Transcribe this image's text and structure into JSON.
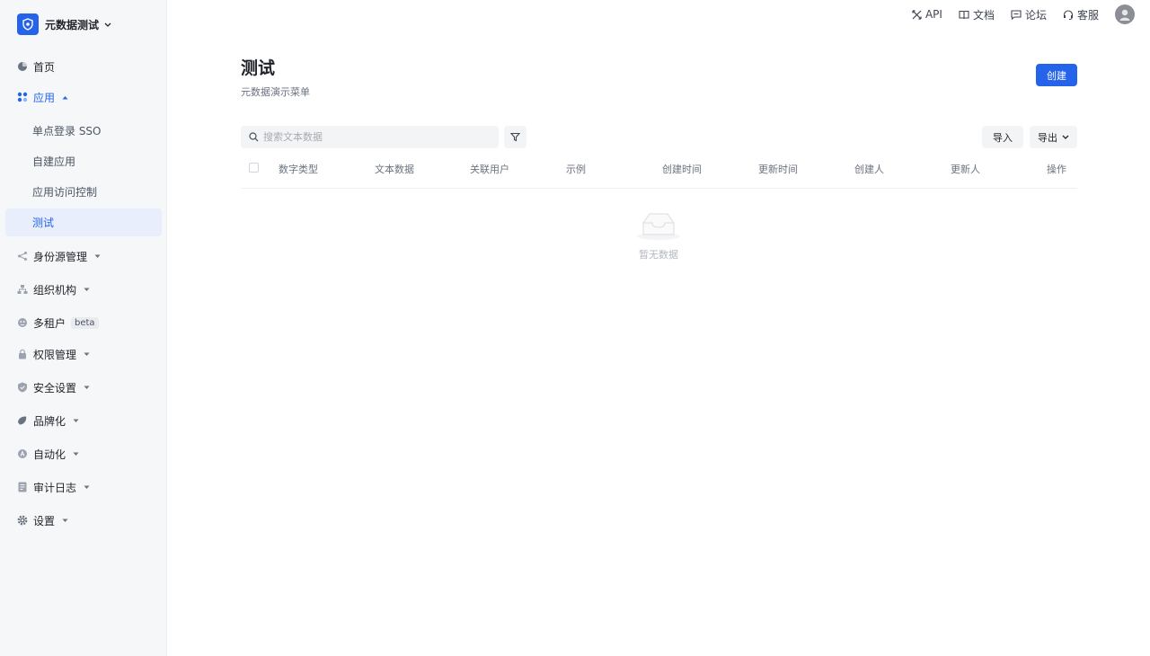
{
  "app": {
    "name": "元数据测试"
  },
  "topbar": {
    "links": [
      {
        "label": "API",
        "icon": "api-icon"
      },
      {
        "label": "文档",
        "icon": "book-icon"
      },
      {
        "label": "论坛",
        "icon": "forum-icon"
      },
      {
        "label": "客服",
        "icon": "headset-icon"
      }
    ]
  },
  "sidebar": {
    "home": "首页",
    "apps": "应用",
    "app_children": [
      "单点登录 SSO",
      "自建应用",
      "应用访问控制",
      "测试"
    ],
    "identity_source": "身份源管理",
    "organization": "组织机构",
    "multi_tenant": "多租户",
    "multi_tenant_badge": "beta",
    "permissions": "权限管理",
    "security": "安全设置",
    "branding": "品牌化",
    "automation": "自动化",
    "audit_log": "审计日志",
    "settings": "设置"
  },
  "page": {
    "title": "测试",
    "description": "元数据演示菜单",
    "create_label": "创建",
    "search_placeholder": "搜索文本数据",
    "import_label": "导入",
    "export_label": "导出"
  },
  "table": {
    "columns": [
      "数字类型",
      "文本数据",
      "关联用户",
      "示例",
      "创建时间",
      "更新时间",
      "创建人",
      "更新人",
      "操作"
    ],
    "rows": [],
    "empty_text": "暂无数据"
  },
  "colors": {
    "accent": "#2563eb",
    "sidebar_bg": "#f6f7f9",
    "active_item_bg": "#e8eefb"
  }
}
